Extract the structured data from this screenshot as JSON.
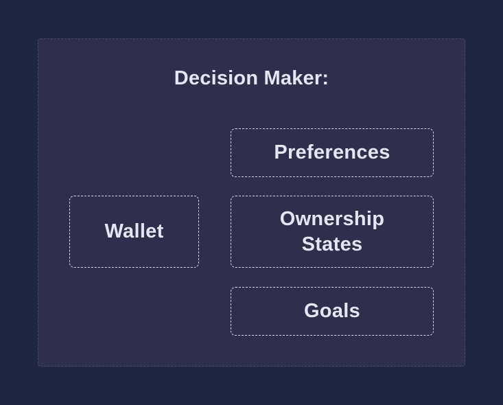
{
  "diagram": {
    "title": "Decision Maker:",
    "components": {
      "wallet": "Wallet",
      "preferences": "Preferences",
      "ownership_states": "Ownership States",
      "goals": "Goals"
    }
  },
  "colors": {
    "background": "#1e2642",
    "panel": "#2e2f4d",
    "text": "#e4e6f4",
    "dashed_border": "#d8dbe8"
  }
}
